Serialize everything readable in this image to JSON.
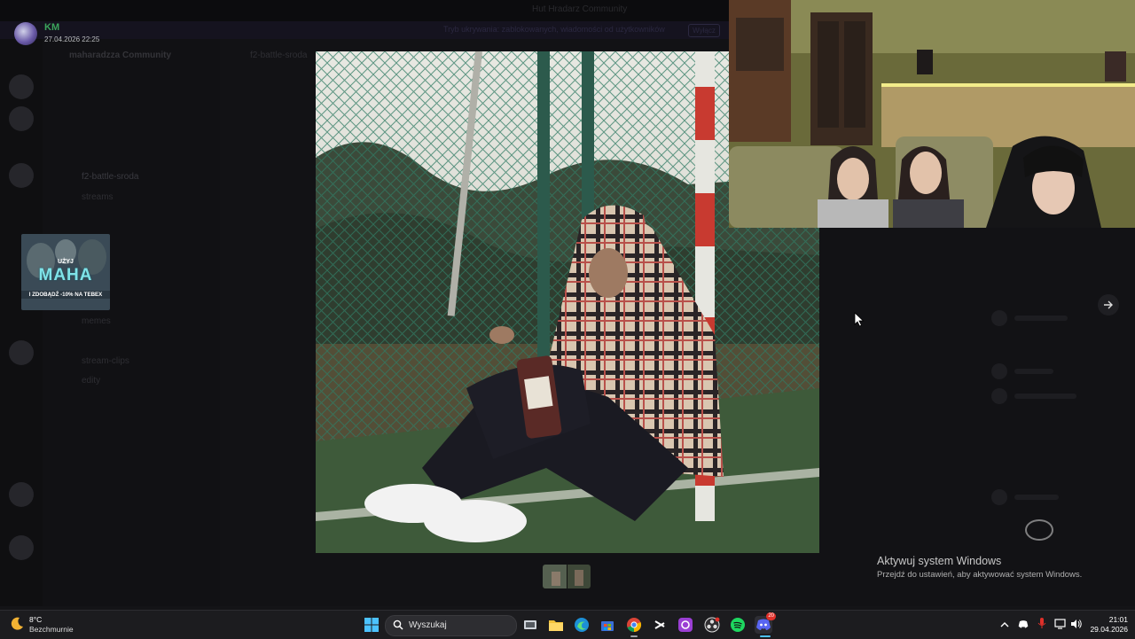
{
  "background": {
    "server_title": "Hut Hradarz Community",
    "banner_text": "Tryb ukrywania: zablokowanych, wiadomości od użytkowników",
    "banner_button": "Wyłącz",
    "server_name": "maharadzza Community",
    "channel_header": "f2-battle-sroda",
    "channels": [
      "f2-battle-sroda",
      "streams",
      "memes",
      "stream-clips",
      "edity"
    ]
  },
  "viewer": {
    "author_initials": "KM",
    "timestamp": "27.04.2026 22:25",
    "icons": {
      "mute": "speaker-muted-icon",
      "next": "arrow-right-icon"
    }
  },
  "promo": {
    "small_text": "UŻYJ",
    "big_text": "MAHA",
    "sub_text": "I ZDOBĄDŹ -10% NA TEBEX"
  },
  "watermark": {
    "title": "Aktywuj system Windows",
    "subtitle": "Przejdź do ustawień, aby aktywować system Windows."
  },
  "taskbar": {
    "temperature": "8°C",
    "weather": "Bezchmurnie",
    "search_placeholder": "Wyszukaj",
    "time": "21:01",
    "date": "29.04.2026",
    "discord_badge": "20"
  },
  "colors": {
    "accent_green": "#3ba55c",
    "promo_cyan": "#7fe3e8",
    "taskbar": "#1c1c1f"
  }
}
